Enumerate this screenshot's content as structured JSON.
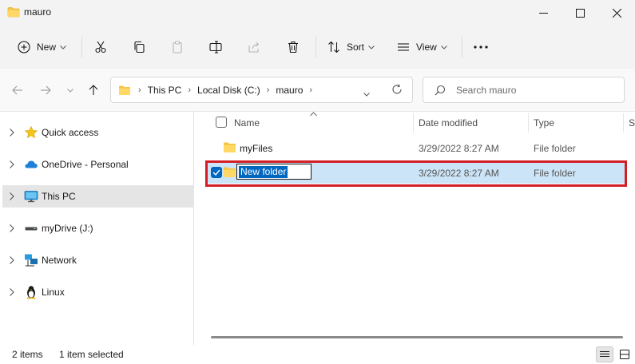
{
  "window": {
    "title": "mauro"
  },
  "toolbar": {
    "new_label": "New",
    "sort_label": "Sort",
    "view_label": "View"
  },
  "address": {
    "crumbs": [
      "This PC",
      "Local Disk (C:)",
      "mauro"
    ],
    "search_placeholder": "Search mauro"
  },
  "nav": {
    "items": [
      {
        "label": "Quick access",
        "icon": "star-icon"
      },
      {
        "label": "OneDrive - Personal",
        "icon": "cloud-icon"
      },
      {
        "label": "This PC",
        "icon": "monitor-icon",
        "selected": true
      },
      {
        "label": "myDrive (J:)",
        "icon": "drive-icon"
      },
      {
        "label": "Network",
        "icon": "network-icon"
      },
      {
        "label": "Linux",
        "icon": "linux-penguin-icon"
      }
    ]
  },
  "columns": {
    "name": "Name",
    "date_modified": "Date modified",
    "type": "Type",
    "size_partial": "S"
  },
  "files": [
    {
      "name": "myFiles",
      "date": "3/29/2022 8:27 AM",
      "type": "File folder"
    },
    {
      "name": "New folder",
      "date": "3/29/2022 8:27 AM",
      "type": "File folder",
      "selected": true,
      "renaming": true
    }
  ],
  "status": {
    "item_count": "2 items",
    "selected_count": "1 item selected"
  },
  "colors": {
    "accent": "#0067c0",
    "selection_bg": "#cce4f7",
    "highlight_border": "#d21f26",
    "folder_yellow": "#f4c542"
  }
}
